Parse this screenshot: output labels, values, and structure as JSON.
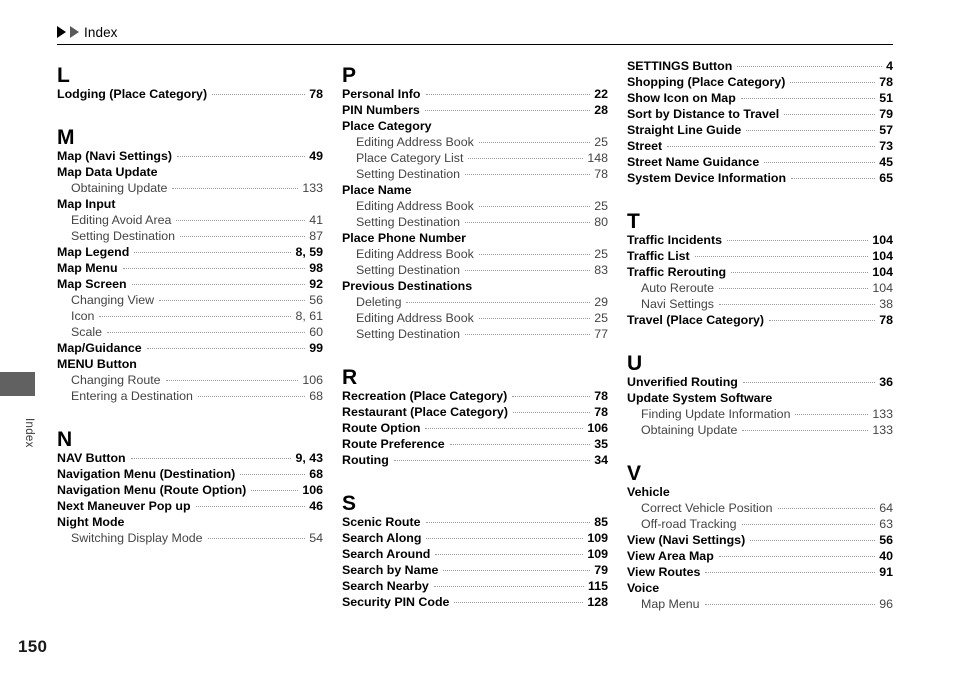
{
  "header": {
    "title": "Index",
    "arrow_icon_1": "triangle-right-icon",
    "arrow_icon_2": "triangle-right-icon"
  },
  "side_tab": {
    "label": "Index"
  },
  "footer": {
    "page_number": "150"
  },
  "columns": [
    {
      "id": "column-1",
      "sections": [
        {
          "letter": "L",
          "entries": [
            {
              "level": "main",
              "label": "Lodging (Place Category)",
              "page": "78"
            }
          ]
        },
        {
          "letter": "M",
          "entries": [
            {
              "level": "main",
              "label": "Map (Navi Settings)",
              "page": "49"
            },
            {
              "level": "main",
              "label": "Map Data Update",
              "page": ""
            },
            {
              "level": "sub",
              "label": "Obtaining Update",
              "page": "133"
            },
            {
              "level": "main",
              "label": "Map Input",
              "page": ""
            },
            {
              "level": "sub",
              "label": "Editing Avoid Area",
              "page": "41"
            },
            {
              "level": "sub",
              "label": "Setting Destination",
              "page": "87"
            },
            {
              "level": "main",
              "label": "Map Legend",
              "page": "8, 59"
            },
            {
              "level": "main",
              "label": "Map Menu",
              "page": "98"
            },
            {
              "level": "main",
              "label": "Map Screen",
              "page": "92"
            },
            {
              "level": "sub",
              "label": "Changing View",
              "page": "56"
            },
            {
              "level": "sub",
              "label": "Icon",
              "page": "8, 61"
            },
            {
              "level": "sub",
              "label": "Scale",
              "page": "60"
            },
            {
              "level": "main",
              "label": "Map/Guidance",
              "page": "99"
            },
            {
              "level": "main",
              "label": "MENU Button",
              "page": ""
            },
            {
              "level": "sub",
              "label": "Changing Route",
              "page": "106"
            },
            {
              "level": "sub",
              "label": "Entering a Destination",
              "page": "68"
            }
          ]
        },
        {
          "letter": "N",
          "entries": [
            {
              "level": "main",
              "label": "NAV Button",
              "page": "9, 43"
            },
            {
              "level": "main",
              "label": "Navigation Menu (Destination)",
              "page": "68"
            },
            {
              "level": "main",
              "label": "Navigation Menu (Route Option)",
              "page": "106"
            },
            {
              "level": "main",
              "label": "Next Maneuver Pop up",
              "page": "46"
            },
            {
              "level": "main",
              "label": "Night Mode",
              "page": ""
            },
            {
              "level": "sub",
              "label": "Switching Display Mode",
              "page": "54"
            }
          ]
        }
      ]
    },
    {
      "id": "column-2",
      "sections": [
        {
          "letter": "P",
          "entries": [
            {
              "level": "main",
              "label": "Personal Info",
              "page": "22"
            },
            {
              "level": "main",
              "label": "PIN Numbers",
              "page": "28"
            },
            {
              "level": "main",
              "label": "Place Category",
              "page": ""
            },
            {
              "level": "sub",
              "label": "Editing Address Book",
              "page": "25"
            },
            {
              "level": "sub",
              "label": "Place Category List",
              "page": "148"
            },
            {
              "level": "sub",
              "label": "Setting Destination",
              "page": "78"
            },
            {
              "level": "main",
              "label": "Place Name",
              "page": ""
            },
            {
              "level": "sub",
              "label": "Editing Address Book",
              "page": "25"
            },
            {
              "level": "sub",
              "label": "Setting Destination",
              "page": "80"
            },
            {
              "level": "main",
              "label": "Place Phone Number",
              "page": ""
            },
            {
              "level": "sub",
              "label": "Editing Address Book",
              "page": "25"
            },
            {
              "level": "sub",
              "label": "Setting Destination",
              "page": "83"
            },
            {
              "level": "main",
              "label": "Previous Destinations",
              "page": ""
            },
            {
              "level": "sub",
              "label": "Deleting",
              "page": "29"
            },
            {
              "level": "sub",
              "label": "Editing Address Book",
              "page": "25"
            },
            {
              "level": "sub",
              "label": "Setting Destination",
              "page": "77"
            }
          ]
        },
        {
          "letter": "R",
          "entries": [
            {
              "level": "main",
              "label": "Recreation (Place Category)",
              "page": "78"
            },
            {
              "level": "main",
              "label": "Restaurant (Place Category)",
              "page": "78"
            },
            {
              "level": "main",
              "label": "Route Option",
              "page": "106"
            },
            {
              "level": "main",
              "label": "Route Preference",
              "page": "35"
            },
            {
              "level": "main",
              "label": "Routing",
              "page": "34"
            }
          ]
        },
        {
          "letter": "S",
          "entries": [
            {
              "level": "main",
              "label": "Scenic Route",
              "page": "85"
            },
            {
              "level": "main",
              "label": "Search Along",
              "page": "109"
            },
            {
              "level": "main",
              "label": "Search Around",
              "page": "109"
            },
            {
              "level": "main",
              "label": "Search by Name",
              "page": "79"
            },
            {
              "level": "main",
              "label": "Search Nearby",
              "page": "115"
            },
            {
              "level": "main",
              "label": "Security PIN Code",
              "page": "128"
            }
          ]
        }
      ]
    },
    {
      "id": "column-3",
      "sections": [
        {
          "letter": "",
          "entries": [
            {
              "level": "main",
              "label": "SETTINGS Button",
              "page": "4"
            },
            {
              "level": "main",
              "label": "Shopping (Place Category)",
              "page": "78"
            },
            {
              "level": "main",
              "label": "Show Icon on Map",
              "page": "51"
            },
            {
              "level": "main",
              "label": "Sort by Distance to Travel",
              "page": "79"
            },
            {
              "level": "main",
              "label": "Straight Line Guide",
              "page": "57"
            },
            {
              "level": "main",
              "label": "Street",
              "page": "73"
            },
            {
              "level": "main",
              "label": "Street Name Guidance",
              "page": "45"
            },
            {
              "level": "main",
              "label": "System Device Information",
              "page": "65"
            }
          ]
        },
        {
          "letter": "T",
          "entries": [
            {
              "level": "main",
              "label": "Traffic Incidents",
              "page": "104"
            },
            {
              "level": "main",
              "label": "Traffic List",
              "page": "104"
            },
            {
              "level": "main",
              "label": "Traffic Rerouting",
              "page": "104"
            },
            {
              "level": "sub",
              "label": "Auto Reroute",
              "page": "104"
            },
            {
              "level": "sub",
              "label": "Navi Settings",
              "page": "38"
            },
            {
              "level": "main",
              "label": "Travel (Place Category)",
              "page": "78"
            }
          ]
        },
        {
          "letter": "U",
          "entries": [
            {
              "level": "main",
              "label": "Unverified Routing",
              "page": "36"
            },
            {
              "level": "main",
              "label": "Update System Software",
              "page": ""
            },
            {
              "level": "sub",
              "label": "Finding Update Information",
              "page": "133"
            },
            {
              "level": "sub",
              "label": "Obtaining Update",
              "page": "133"
            }
          ]
        },
        {
          "letter": "V",
          "entries": [
            {
              "level": "main",
              "label": "Vehicle",
              "page": ""
            },
            {
              "level": "sub",
              "label": "Correct Vehicle Position",
              "page": "64"
            },
            {
              "level": "sub",
              "label": "Off-road Tracking",
              "page": "63"
            },
            {
              "level": "main",
              "label": "View (Navi Settings)",
              "page": "56"
            },
            {
              "level": "main",
              "label": "View Area Map",
              "page": "40"
            },
            {
              "level": "main",
              "label": "View Routes",
              "page": "91"
            },
            {
              "level": "main",
              "label": "Voice",
              "page": ""
            },
            {
              "level": "sub",
              "label": "Map Menu",
              "page": "96"
            }
          ]
        }
      ]
    }
  ]
}
